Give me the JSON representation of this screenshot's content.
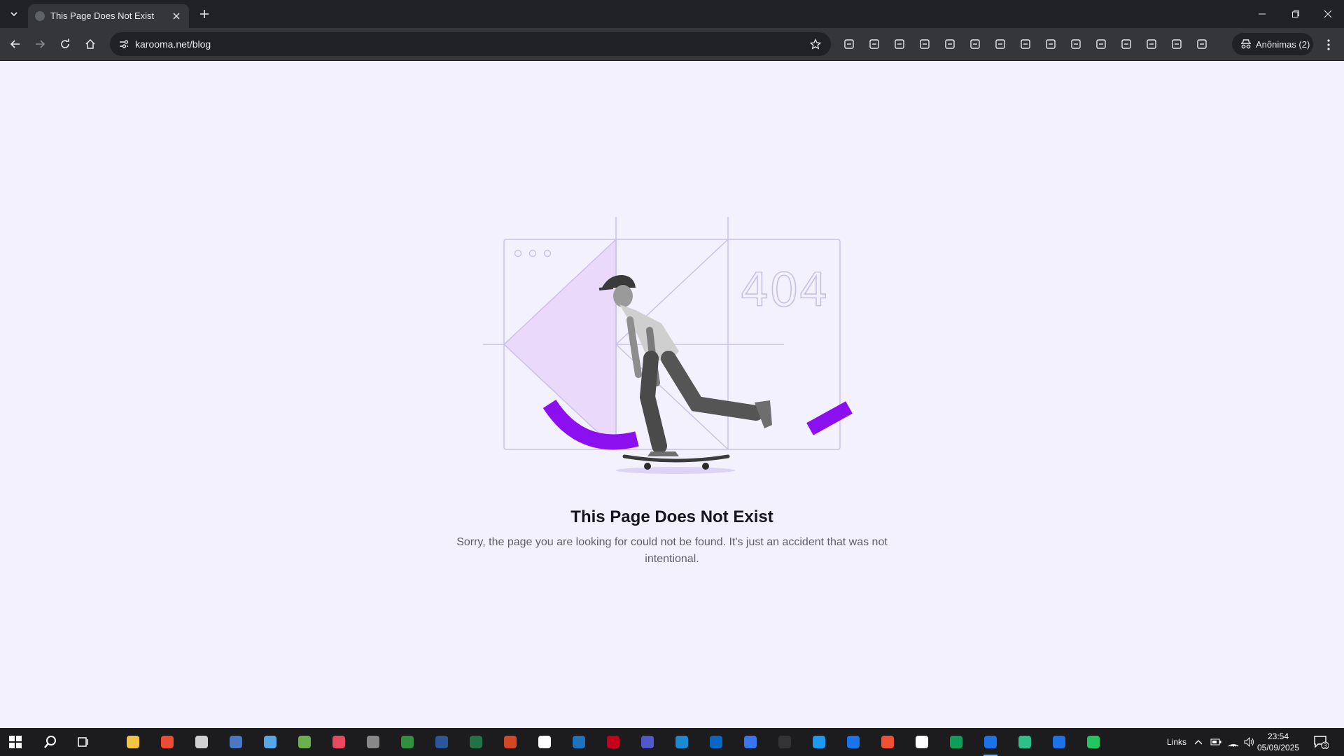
{
  "browser": {
    "tab": {
      "title": "This Page Does Not Exist"
    },
    "address": {
      "url": "karooma.net/blog"
    },
    "profile": {
      "label": "Anônimas (2)"
    },
    "extensions": [
      "incognito-icon",
      "key-icon",
      "location-pin-icon",
      "reader-icon",
      "download-icon",
      "print-icon",
      "screenshot-icon",
      "translate-icon",
      "qr-code-icon",
      "reading-mode-icon",
      "link-icon",
      "cast-icon",
      "tab-search-icon",
      "code-icon",
      "favorites-icon"
    ]
  },
  "page": {
    "illustration": {
      "code": "404"
    },
    "heading": "This Page Does Not Exist",
    "message": "Sorry, the page you are looking for could not be found. It's just an accident that was not intentional."
  },
  "taskbar": {
    "apps": [
      "file-explorer-icon",
      "filezilla-icon",
      "mail-icon",
      "calculator-icon",
      "notepad-icon",
      "app-green-icon",
      "bug-icon",
      "usb-icon",
      "edge-icon",
      "word-icon",
      "excel-icon",
      "powerpoint-icon",
      "file-icon",
      "powershell-icon",
      "antivirus-icon",
      "teams-icon",
      "vscode-icon",
      "outlook-icon",
      "signal-icon",
      "terminal-icon",
      "docker-icon",
      "chrome-icon",
      "git-icon",
      "capcut-icon",
      "drive-icon",
      "chrome-active-icon",
      "app-hex-icon",
      "chrome-2-icon",
      "app-k-icon"
    ],
    "links_label": "Links",
    "time": "23:54",
    "date": "05/09/2025",
    "notification_count": "3"
  },
  "colors": {
    "accent": "#8c0ff0",
    "lavender": "#ebd9fc",
    "line": "#c9bfe4",
    "page_bg": "#f4f1fe"
  }
}
